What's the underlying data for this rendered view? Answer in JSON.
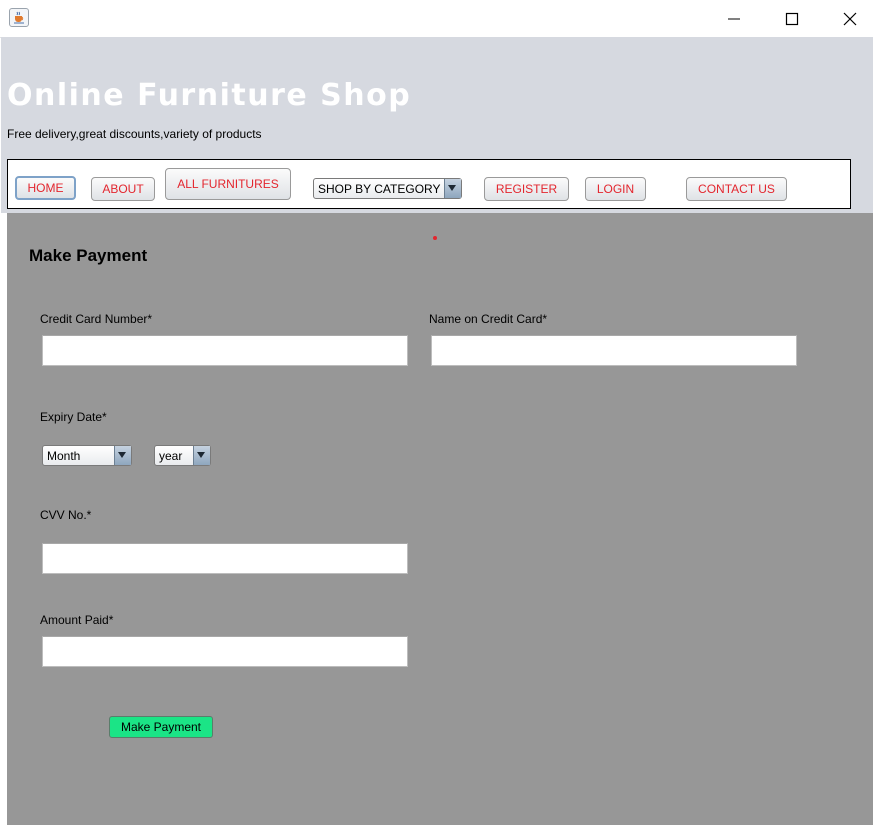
{
  "window": {
    "app_icon": "java-cup-icon",
    "controls": [
      "minimize-icon",
      "maximize-icon",
      "close-icon"
    ]
  },
  "header": {
    "title": "Online Furniture Shop",
    "subtitle": "Free delivery,great discounts,variety of products"
  },
  "nav": {
    "home": "HOME",
    "about": "ABOUT",
    "all_furnitures": "ALL FURNITURES",
    "category_select": "SHOP BY CATEGORY",
    "register": "REGISTER",
    "login": "LOGIN",
    "contact": "CONTACT US"
  },
  "form": {
    "title": "Make Payment",
    "card_number_label": "Credit Card Number*",
    "card_number_value": "",
    "card_name_label": "Name on Credit Card*",
    "card_name_value": "",
    "expiry_label": "Expiry Date*",
    "month_select": "Month",
    "year_select": "year",
    "cvv_label": "CVV No.*",
    "cvv_value": "",
    "amount_label": "Amount Paid*",
    "amount_value": "",
    "submit_label": "Make Payment"
  },
  "colors": {
    "nav_text": "#e3262e",
    "header_bg": "#d6d9e0",
    "panel_bg": "#979797",
    "submit_bg": "#1be486"
  }
}
